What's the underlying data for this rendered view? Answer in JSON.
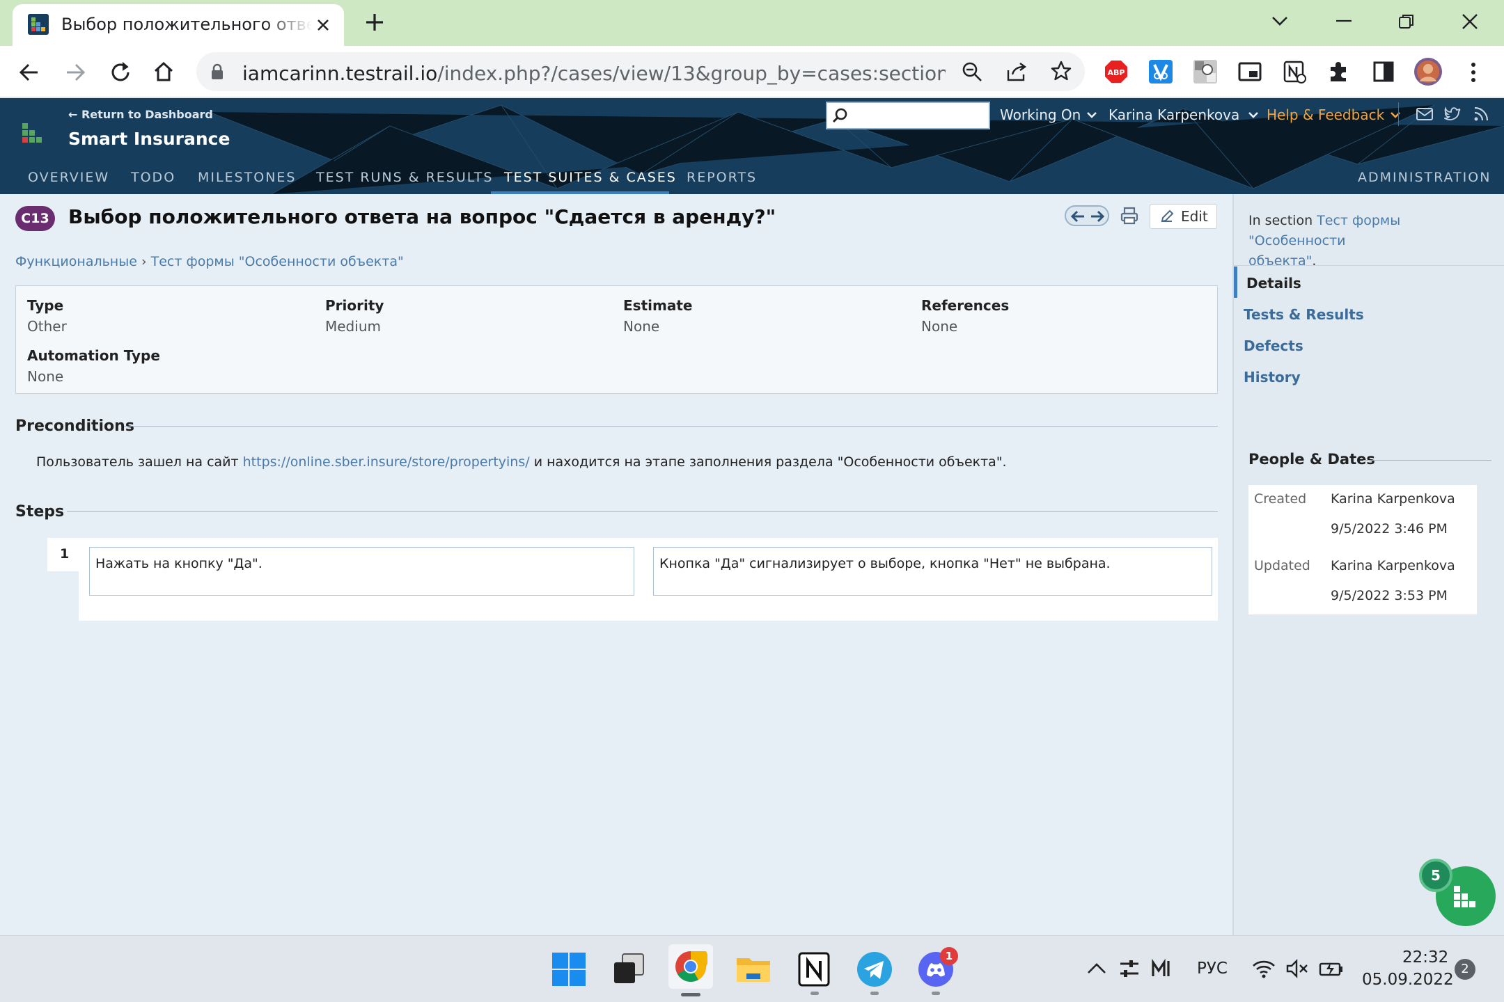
{
  "browser": {
    "tab_title": "Выбор положительного ответа на вопрос \"Сдается в аренду?\"",
    "url_host": "iamcarinn.testrail.io",
    "url_path": "/index.php?/cases/view/13&group_by=cases:section_id&gro..."
  },
  "header": {
    "back_link": "← Return to Dashboard",
    "project": "Smart Insurance",
    "search_placeholder": "",
    "working_on": "Working On",
    "user": "Karina Karpenkova",
    "help": "Help & Feedback",
    "nav": [
      "OVERVIEW",
      "TODO",
      "MILESTONES",
      "TEST RUNS & RESULTS",
      "TEST SUITES & CASES",
      "REPORTS"
    ],
    "admin": "ADMINISTRATION",
    "active_tab": "TEST SUITES & CASES"
  },
  "case": {
    "id_badge": "C13",
    "title": "Выбор положительного ответа на вопрос \"Сдается в аренду?\"",
    "edit_label": "Edit",
    "breadcrumb": [
      "Функциональные",
      "›",
      "Тест формы \"Особенности объекта\""
    ],
    "fields": [
      {
        "label": "Type",
        "value": "Other"
      },
      {
        "label": "Priority",
        "value": "Medium"
      },
      {
        "label": "Estimate",
        "value": "None"
      },
      {
        "label": "References",
        "value": "None"
      },
      {
        "label": "Automation Type",
        "value": "None"
      }
    ],
    "preconditions_title": "Preconditions",
    "preconditions_text_before": "Пользователь зашел на сайт ",
    "preconditions_link": "https://online.sber.insure/store/propertyins/",
    "preconditions_text_after": " и находится на этапе заполнения раздела \"Особенности объекта\".",
    "steps_title": "Steps",
    "steps": [
      {
        "number": "1",
        "action": "Нажать на кнопку \"Да\".",
        "expected": "Кнопка \"Да\" сигнализирует о выборе, кнопка \"Нет\" не выбрана."
      }
    ]
  },
  "sidebar": {
    "in_section_prefix": "In section ",
    "in_section_link_1": "Тест формы \"Особенности",
    "in_section_link_2": "объекта\"",
    "in_section_suffix": ".",
    "links": [
      "Details",
      "Tests & Results",
      "Defects",
      "History"
    ],
    "active_link": "Details",
    "people_title": "People & Dates",
    "created_label": "Created",
    "created_by": "Karina Karpenkova",
    "created_at": "9/5/2022 3:46 PM",
    "updated_label": "Updated",
    "updated_by": "Karina Karpenkova",
    "updated_at": "9/5/2022 3:53 PM",
    "fab_badge": "5"
  },
  "taskbar": {
    "lang": "РУС",
    "time": "22:32",
    "date": "05.09.2022",
    "notif_count": "2",
    "discord_badge": "1"
  },
  "colors": {
    "header_bg": "#163d5b",
    "accent": "#3e7fbf",
    "badge": "#6a2d6f",
    "help": "#f3a43a",
    "fab": "#27a85a"
  }
}
